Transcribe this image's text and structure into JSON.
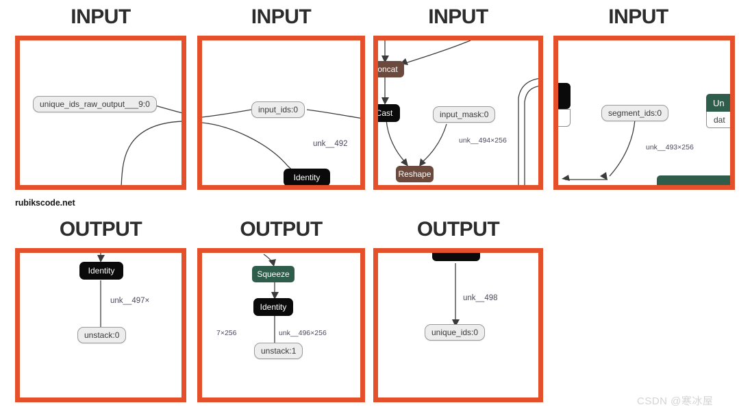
{
  "captions": {
    "input": "INPUT",
    "output": "OUTPUT"
  },
  "watermarks": {
    "rubikscode": "rubikscode.net",
    "csdn": "CSDN @寒冰屋"
  },
  "colors": {
    "panel_border": "#e4502a",
    "caption_text": "#2c2c2c",
    "identity_node": "#0a0a0a",
    "brown_node": "#6b4a3d",
    "green_node": "#2f5d4b",
    "io_node_fill": "#ededed",
    "edge_label_text": "#4a4a5e",
    "edge_stroke": "#3b3b3b"
  },
  "panels": {
    "input_1": {
      "caption": "INPUT",
      "nodes": [
        {
          "id": "unique_ids_raw",
          "label": "unique_ids_raw_output___9:0",
          "type": "io"
        }
      ],
      "edge_labels": []
    },
    "input_2": {
      "caption": "INPUT",
      "nodes": [
        {
          "id": "input_ids",
          "label": "input_ids:0",
          "type": "io"
        },
        {
          "id": "identity",
          "label": "Identity",
          "type": "identity"
        }
      ],
      "edge_labels": [
        {
          "id": "unk_492",
          "label": "unk__492"
        }
      ]
    },
    "input_3": {
      "caption": "INPUT",
      "nodes": [
        {
          "id": "concat",
          "label": "oncat",
          "type": "brown"
        },
        {
          "id": "cast",
          "label": "Cast",
          "type": "identity"
        },
        {
          "id": "input_mask",
          "label": "input_mask:0",
          "type": "io"
        },
        {
          "id": "reshape",
          "label": "Reshape",
          "type": "brown"
        }
      ],
      "edge_labels": [
        {
          "id": "unk_494",
          "label": "unk__494×256"
        }
      ]
    },
    "input_4": {
      "caption": "INPUT",
      "nodes": [
        {
          "id": "black_clipped",
          "label": "",
          "type": "blackblock"
        },
        {
          "id": "segment_ids",
          "label": "segment_ids:0",
          "type": "io"
        },
        {
          "id": "un_header",
          "label": "Un",
          "type": "green_header"
        },
        {
          "id": "dat_body",
          "label": "dat",
          "type": "white_body"
        },
        {
          "id": "green_clipped",
          "label": "",
          "type": "green"
        }
      ],
      "edge_labels": [
        {
          "id": "unk_493",
          "label": "unk__493×256"
        }
      ]
    },
    "output_1": {
      "caption": "OUTPUT",
      "nodes": [
        {
          "id": "identity",
          "label": "Identity",
          "type": "identity"
        },
        {
          "id": "unstack0",
          "label": "unstack:0",
          "type": "io"
        }
      ],
      "edge_labels": [
        {
          "id": "unk_497",
          "label": "unk__497×"
        }
      ]
    },
    "output_2": {
      "caption": "OUTPUT",
      "nodes": [
        {
          "id": "squeeze",
          "label": "Squeeze",
          "type": "green"
        },
        {
          "id": "identity",
          "label": "Identity",
          "type": "identity"
        },
        {
          "id": "unstack1",
          "label": "unstack:1",
          "type": "io"
        }
      ],
      "edge_labels": [
        {
          "id": "dim_7x256",
          "label": "7×256"
        },
        {
          "id": "unk_496",
          "label": "unk__496×256"
        }
      ]
    },
    "output_3": {
      "caption": "OUTPUT",
      "nodes": [
        {
          "id": "black_clipped",
          "label": "",
          "type": "blackblock"
        },
        {
          "id": "unique_ids",
          "label": "unique_ids:0",
          "type": "io"
        }
      ],
      "edge_labels": [
        {
          "id": "unk_498",
          "label": "unk__498"
        }
      ]
    }
  }
}
